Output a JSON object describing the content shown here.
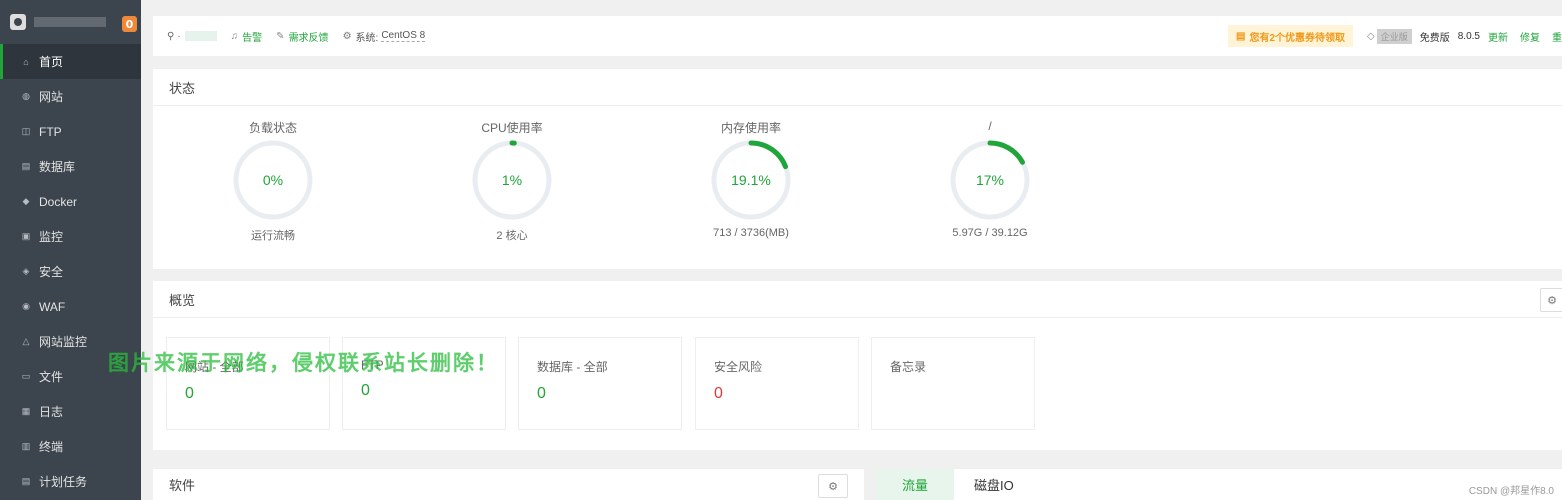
{
  "sidebar": {
    "badge": "0",
    "items": [
      {
        "label": "首页",
        "icon": "home-icon",
        "glyph": "⌂"
      },
      {
        "label": "网站",
        "icon": "globe-icon",
        "glyph": "◍"
      },
      {
        "label": "FTP",
        "icon": "ftp-icon",
        "glyph": "◫"
      },
      {
        "label": "数据库",
        "icon": "database-icon",
        "glyph": "▤"
      },
      {
        "label": "Docker",
        "icon": "docker-icon",
        "glyph": "◆"
      },
      {
        "label": "监控",
        "icon": "monitor-icon",
        "glyph": "▣"
      },
      {
        "label": "安全",
        "icon": "shield-icon",
        "glyph": "◈"
      },
      {
        "label": "WAF",
        "icon": "waf-icon",
        "glyph": "◉"
      },
      {
        "label": "网站监控",
        "icon": "site-monitor-icon",
        "glyph": "△"
      },
      {
        "label": "文件",
        "icon": "folder-icon",
        "glyph": "▭"
      },
      {
        "label": "日志",
        "icon": "log-icon",
        "glyph": "▦"
      },
      {
        "label": "终端",
        "icon": "terminal-icon",
        "glyph": "▥"
      },
      {
        "label": "计划任务",
        "icon": "task-icon",
        "glyph": "▤"
      }
    ]
  },
  "topbar": {
    "user_prefix": "·",
    "alarm_label": "告警",
    "feedback_label": "需求反馈",
    "system_label": "系统:",
    "system_value": "CentOS 8",
    "coupon_label": "您有2个优惠券待领取",
    "enterprise_tag": "企业版",
    "free_label": "免费版",
    "version": "8.0.5",
    "update_label": "更新",
    "repair_label": "修复",
    "restart_label": "重"
  },
  "status": {
    "title": "状态",
    "gauges": [
      {
        "title": "负载状态",
        "value_text": "0%",
        "fraction": 0.0,
        "sub": "运行流畅"
      },
      {
        "title": "CPU使用率",
        "value_text": "1%",
        "fraction": 0.01,
        "sub": "2 核心"
      },
      {
        "title": "内存使用率",
        "value_text": "19.1%",
        "fraction": 0.191,
        "sub": "713 / 3736(MB)"
      },
      {
        "title": "/",
        "value_text": "17%",
        "fraction": 0.17,
        "sub": "5.97G / 39.12G"
      }
    ]
  },
  "overview": {
    "title": "概览",
    "boxes": [
      {
        "label": "网站 - 全部",
        "value": "0"
      },
      {
        "label": "FTP",
        "value": "0"
      },
      {
        "label": "数据库 - 全部",
        "value": "0"
      },
      {
        "label": "安全风险",
        "value": "0"
      },
      {
        "label": "备忘录",
        "value": ""
      }
    ]
  },
  "software": {
    "title": "软件"
  },
  "traffic": {
    "tabs": [
      "流量",
      "磁盘IO"
    ]
  },
  "watermark": "图片来源于网络，侵权联系站长删除！",
  "credit": "CSDN @邦星作8.0",
  "colors": {
    "accent": "#20a53a",
    "danger": "#e73636",
    "warning": "#f09a1a",
    "sidebar": "#3c444d"
  }
}
